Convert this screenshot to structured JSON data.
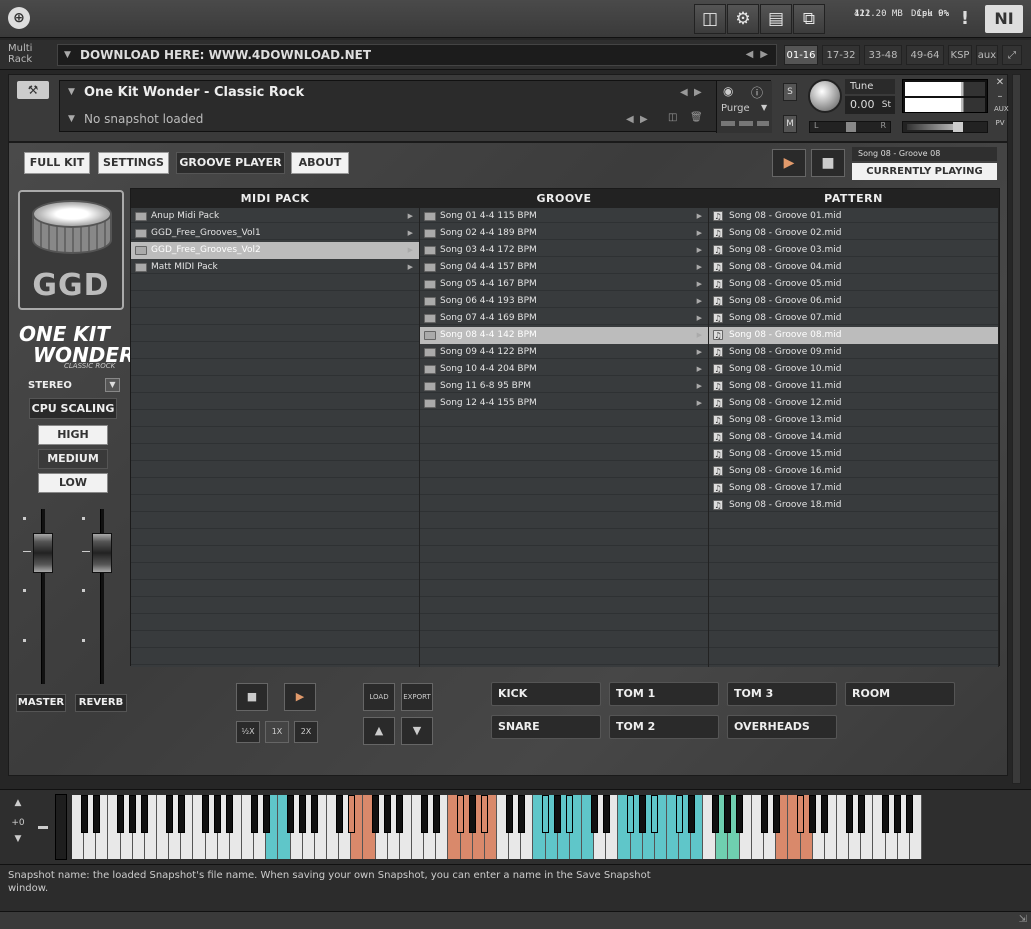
{
  "topbar": {
    "logo": "⊕",
    "buttons": [
      "save-icon",
      "gear-icon",
      "layout-icon",
      "resize-icon"
    ],
    "voices": "112",
    "memory": "421.20 MB",
    "cpu_label": "Cpu",
    "cpu_value": "9%",
    "disk_label": "Disk",
    "disk_value": "0%",
    "warning": "!",
    "ni_logo": "NI"
  },
  "rack": {
    "label_line1": "Multi",
    "label_line2": "Rack",
    "field": "DOWNLOAD HERE: WWW.4DOWNLOAD.NET",
    "tabs": [
      "01-16",
      "17-32",
      "33-48",
      "49-64",
      "KSP",
      "aux"
    ],
    "active_tab": "01-16"
  },
  "instrument": {
    "name": "One Kit Wonder - Classic Rock",
    "snapshot": "No snapshot loaded",
    "purge": "Purge",
    "solo": "S",
    "mute": "M",
    "tune_label": "Tune",
    "tune_value": "0.00",
    "tune_unit": "St",
    "pan_left": "L",
    "pan_right": "R",
    "aux": "AUX",
    "pv": "PV"
  },
  "tabs": [
    {
      "label": "FULL KIT",
      "active": false
    },
    {
      "label": "SETTINGS",
      "active": false
    },
    {
      "label": "GROOVE PLAYER",
      "active": true
    },
    {
      "label": "ABOUT",
      "active": false
    }
  ],
  "now": {
    "song": "Song 08 - Groove 08",
    "status": "CURRENTLY PLAYING"
  },
  "left": {
    "logo": "GGD",
    "brand_line1": "ONE KIT",
    "brand_line2": "WONDER",
    "brand_sub": "CLASSIC ROCK",
    "stereo": "STEREO",
    "cpu_label": "CPU SCALING",
    "cpu_options": [
      "HIGH",
      "MEDIUM",
      "LOW"
    ],
    "cpu_selected": "MEDIUM",
    "fader_master": "MASTER",
    "fader_reverb": "REVERB"
  },
  "browser": {
    "col_midi": "MIDI PACK",
    "col_groove": "GROOVE",
    "col_pattern": "PATTERN",
    "midi_packs": [
      "Anup Midi Pack",
      "GGD_Free_Grooves_Vol1",
      "GGD_Free_Grooves_Vol2",
      "Matt MIDI Pack"
    ],
    "midi_selected": 2,
    "grooves": [
      "Song 01 4-4 115 BPM",
      "Song 02 4-4 189 BPM",
      "Song 03 4-4 172 BPM",
      "Song 04 4-4 157 BPM",
      "Song 05 4-4 167 BPM",
      "Song 06 4-4 193 BPM",
      "Song 07 4-4 169 BPM",
      "Song 08 4-4 142 BPM",
      "Song 09 4-4 122 BPM",
      "Song 10 4-4 204 BPM",
      "Song 11 6-8 95 BPM",
      "Song 12 4-4 155 BPM"
    ],
    "groove_selected": 7,
    "patterns": [
      "Song 08 - Groove 01.mid",
      "Song 08 - Groove 02.mid",
      "Song 08 - Groove 03.mid",
      "Song 08 - Groove 04.mid",
      "Song 08 - Groove 05.mid",
      "Song 08 - Groove 06.mid",
      "Song 08 - Groove 07.mid",
      "Song 08 - Groove 08.mid",
      "Song 08 - Groove 09.mid",
      "Song 08 - Groove 10.mid",
      "Song 08 - Groove 11.mid",
      "Song 08 - Groove 12.mid",
      "Song 08 - Groove 13.mid",
      "Song 08 - Groove 14.mid",
      "Song 08 - Groove 15.mid",
      "Song 08 - Groove 16.mid",
      "Song 08 - Groove 17.mid",
      "Song 08 - Groove 18.mid"
    ],
    "pattern_selected": 7
  },
  "controls": {
    "speed": [
      "½X",
      "1X",
      "2X"
    ],
    "load": "LOAD",
    "export": "EXPORT",
    "up": "▲",
    "down": "▼",
    "stop": "■",
    "play": "▶"
  },
  "mixer": [
    "KICK",
    "TOM 1",
    "TOM 3",
    "ROOM",
    "SNARE",
    "TOM 2",
    "OVERHEADS"
  ],
  "keyboard": {
    "octave": "+0",
    "highlight_colors": {
      "cyan": "#5fc6c9",
      "orange": "#d9896b",
      "green": "#6fcfb0"
    }
  },
  "status": {
    "line1": "Snapshot name: the loaded Snapshot's file name. When saving your own Snapshot, you can enter a name in the Save Snapshot",
    "line2": "window."
  }
}
